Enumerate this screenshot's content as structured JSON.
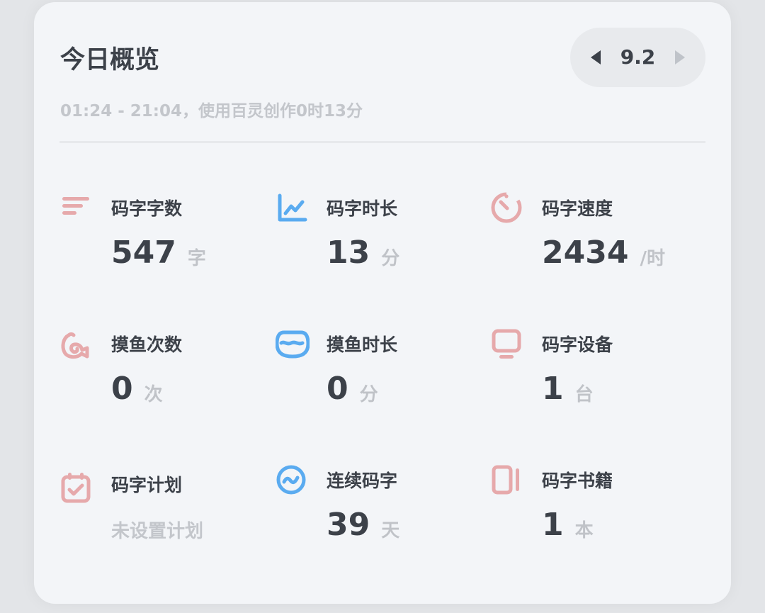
{
  "overview": {
    "title": "今日概览",
    "date": "9.2",
    "subtitle": "01:24 - 21:04，使用百灵创作0时13分"
  },
  "colors": {
    "accent_pink": "#e6a9ab",
    "accent_blue": "#5aabf0",
    "text_primary": "#3c4149",
    "text_muted": "#c0c3c8"
  },
  "stats": [
    {
      "icon": "text-lines-icon",
      "label": "码字字数",
      "value": "547",
      "unit": "字"
    },
    {
      "icon": "line-chart-icon",
      "label": "码字时长",
      "value": "13",
      "unit": "分"
    },
    {
      "icon": "timer-icon",
      "label": "码字速度",
      "value": "2434",
      "unit": "/时"
    },
    {
      "icon": "fish-icon",
      "label": "摸鱼次数",
      "value": "0",
      "unit": "次"
    },
    {
      "icon": "fish-tank-icon",
      "label": "摸鱼时长",
      "value": "0",
      "unit": "分"
    },
    {
      "icon": "monitor-icon",
      "label": "码字设备",
      "value": "1",
      "unit": "台"
    },
    {
      "icon": "calendar-check-icon",
      "label": "码字计划",
      "note": "未设置计划"
    },
    {
      "icon": "streak-icon",
      "label": "连续码字",
      "value": "39",
      "unit": "天"
    },
    {
      "icon": "book-icon",
      "label": "码字书籍",
      "value": "1",
      "unit": "本"
    }
  ]
}
